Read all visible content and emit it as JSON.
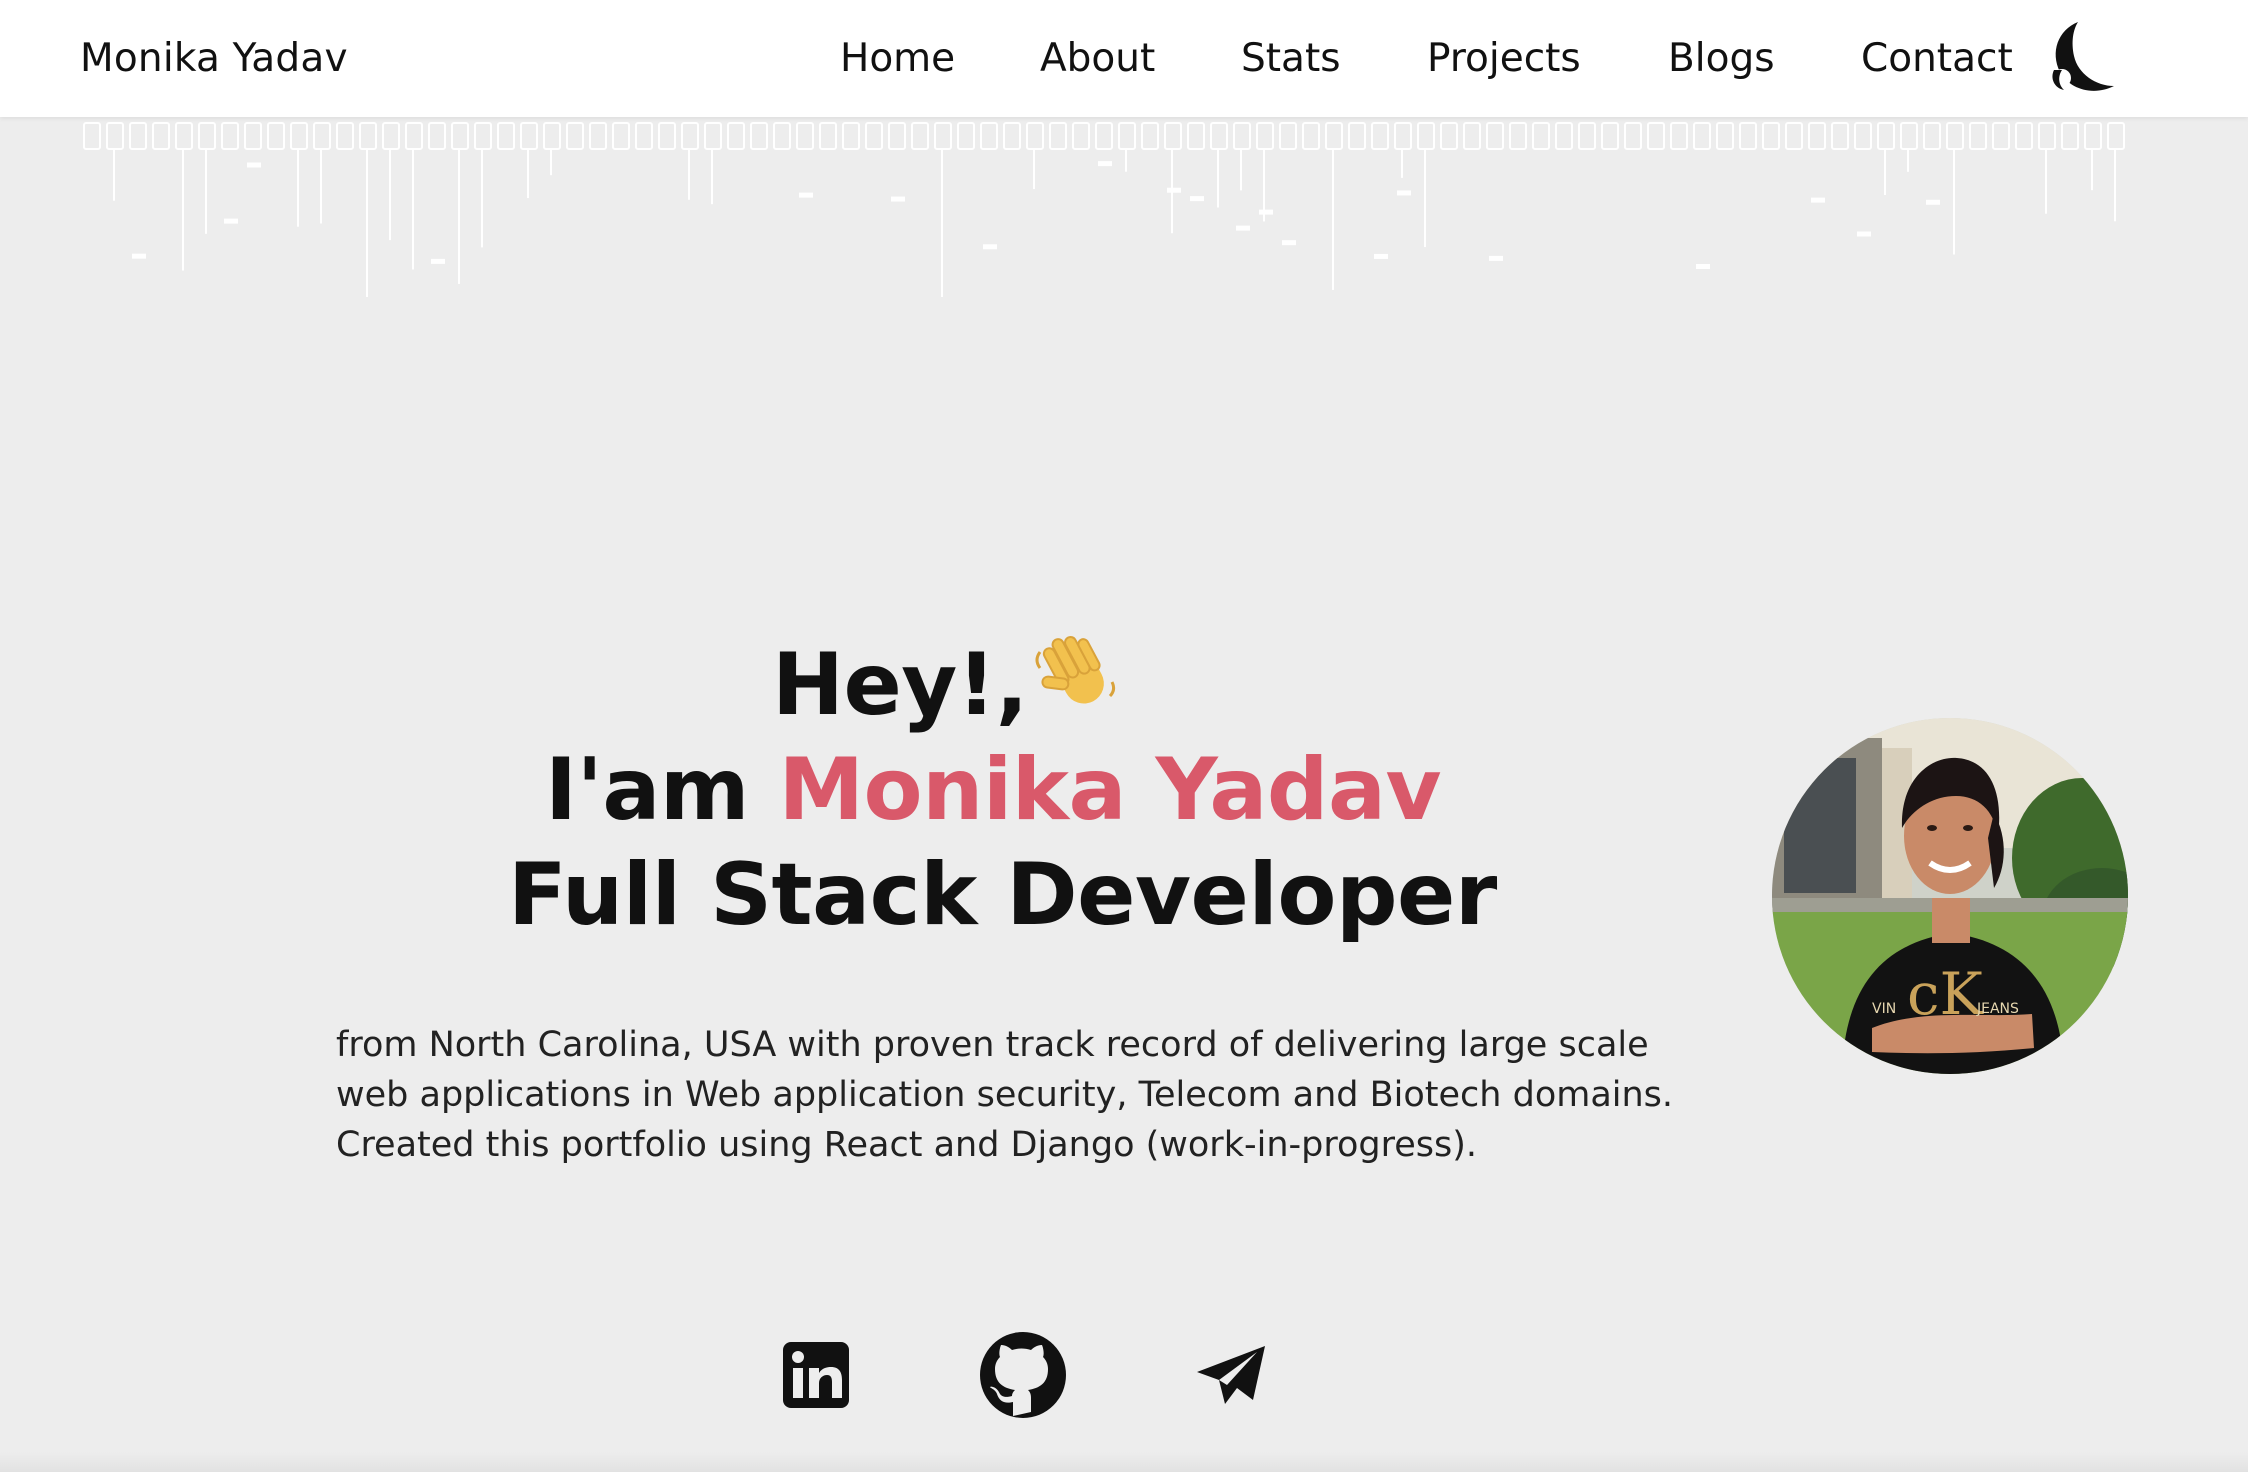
{
  "nav": {
    "brand": "Monika Yadav",
    "links": [
      {
        "label": "Home"
      },
      {
        "label": "About"
      },
      {
        "label": "Stats"
      },
      {
        "label": "Projects"
      },
      {
        "label": "Blogs"
      },
      {
        "label": "Contact"
      }
    ],
    "theme_toggle_icon": "moon-icon"
  },
  "hero": {
    "greeting": "Hey!,",
    "greeting_emoji_icon": "waving-hand-icon",
    "intro_prefix": "I'am",
    "name": "Monika Yadav",
    "role": "Full Stack Developer",
    "bio": "from North Carolina, USA with proven track record of delivering large scale web applications in Web application security, Telecom and Biotech domains. Created this portfolio using React and Django (work-in-progress).",
    "avatar_icon": "profile-photo"
  },
  "social": [
    {
      "icon": "linkedin-icon"
    },
    {
      "icon": "github-icon"
    },
    {
      "icon": "telegram-icon"
    }
  ],
  "colors": {
    "accent": "#d9596a",
    "background": "#ededed",
    "navbar": "#ffffff",
    "text": "#111111"
  }
}
